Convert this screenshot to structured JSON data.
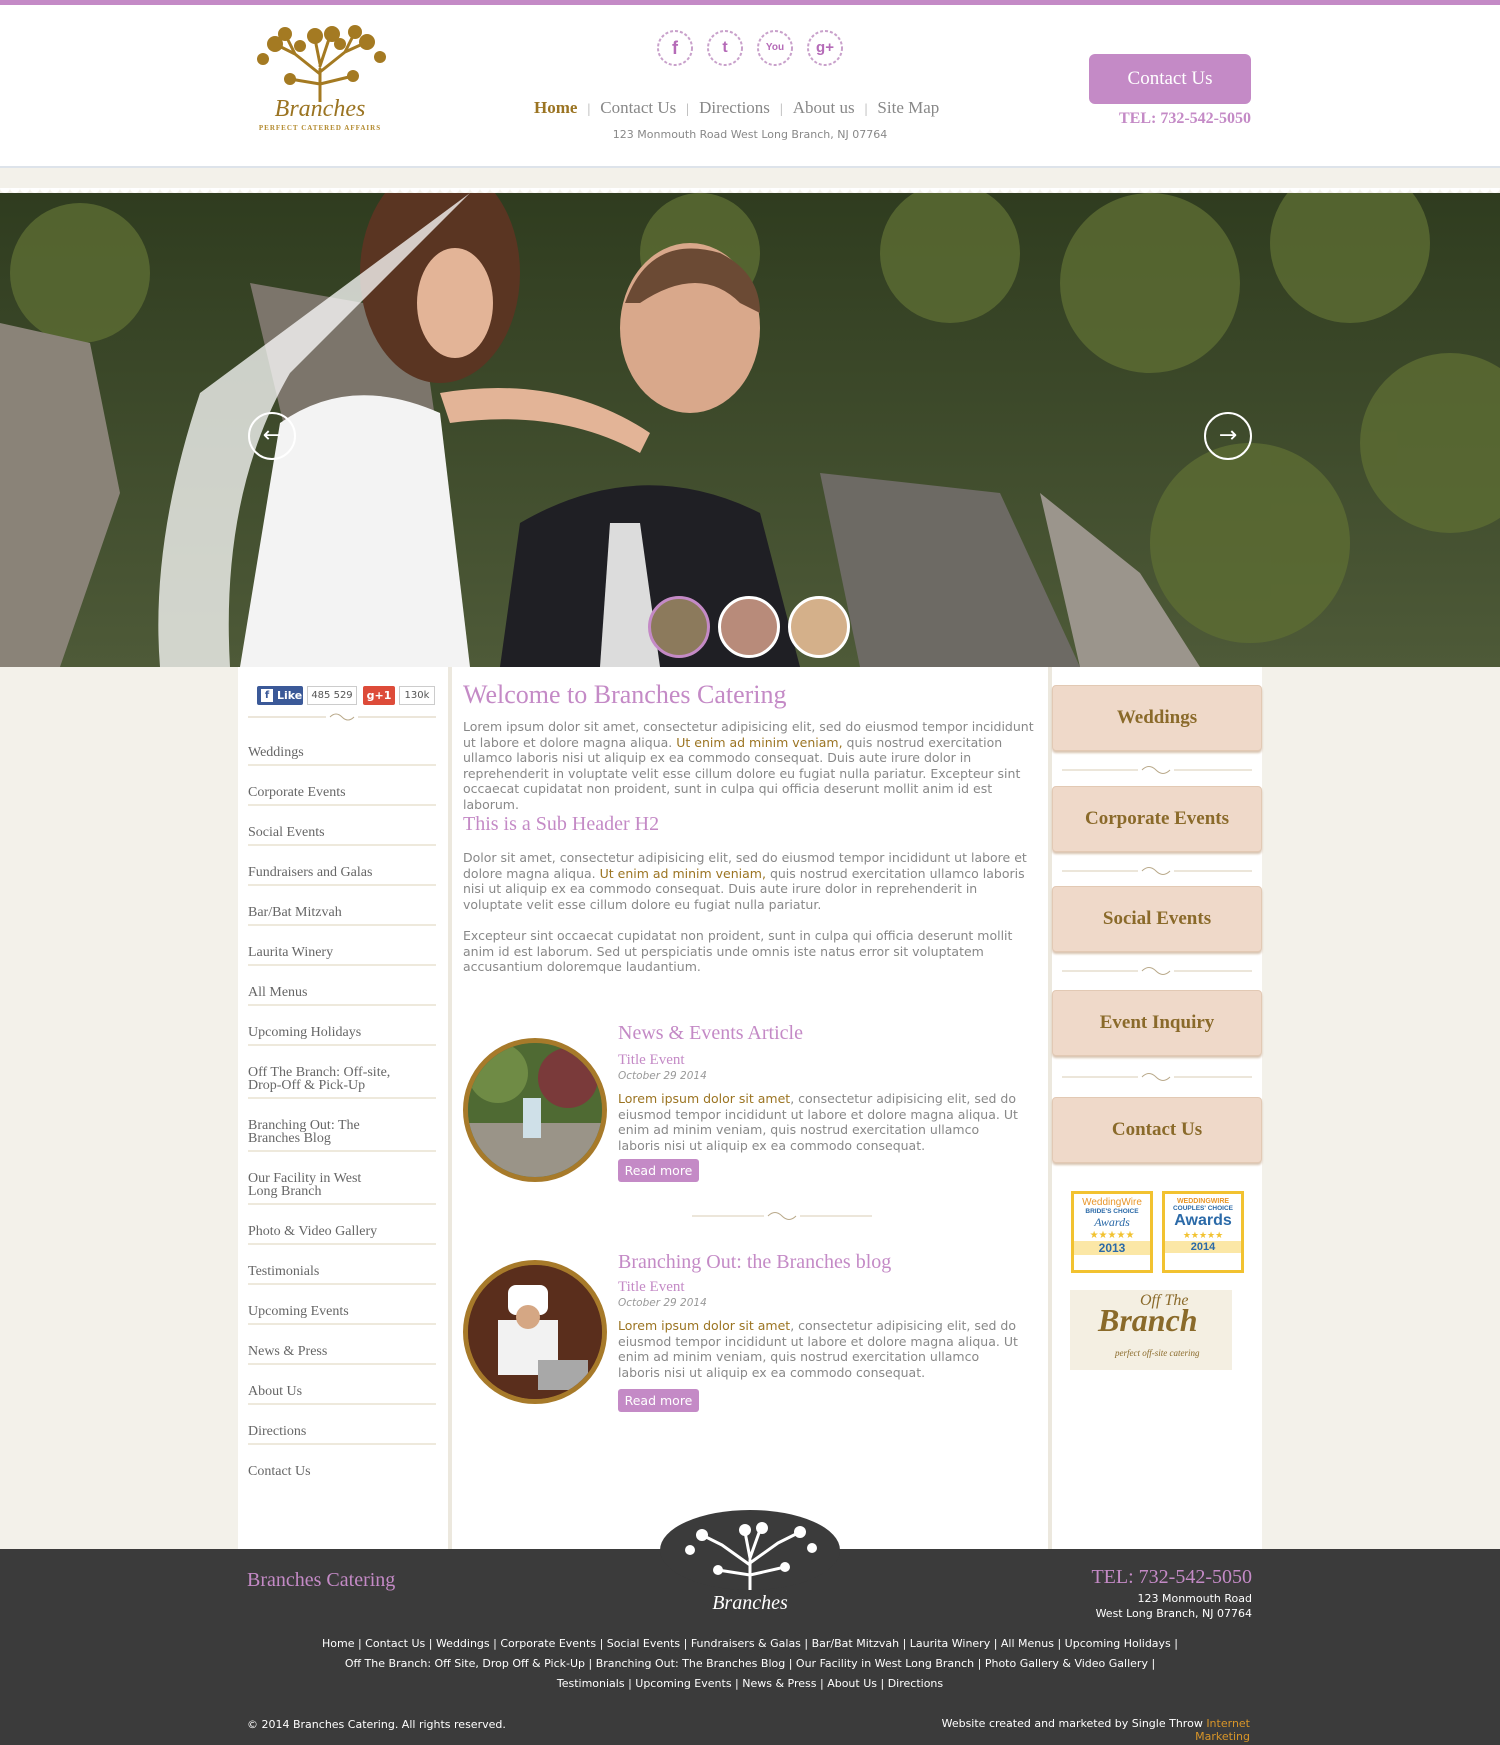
{
  "header": {
    "logo_brand": "Branches",
    "logo_tagline": "PERFECT CATERED AFFAIRS",
    "social": [
      {
        "icon": "facebook-icon",
        "glyph": "f"
      },
      {
        "icon": "twitter-icon",
        "glyph": "t"
      },
      {
        "icon": "youtube-icon",
        "glyph": "You"
      },
      {
        "icon": "google-plus-icon",
        "glyph": "g+"
      }
    ],
    "nav": [
      "Home",
      "Contact Us",
      "Directions",
      "About us",
      "Site Map"
    ],
    "address": "123 Monmouth Road West Long Branch, NJ 07764",
    "contact_button": "Contact Us",
    "tel": "TEL: 732-542-5050"
  },
  "hero": {
    "prev_arrow": "←",
    "next_arrow": "→"
  },
  "left_social": {
    "fb_like": "Like",
    "fb_count": "485 529",
    "gplus": "g+1",
    "gplus_count": "130k"
  },
  "left_menu": [
    "Weddings",
    "Corporate Events",
    "Social Events",
    "Fundraisers and Galas",
    "Bar/Bat Mitzvah",
    "Laurita Winery",
    "All Menus",
    "Upcoming Holidays",
    "Off The Branch: Off-site,",
    "Drop-Off & Pick-Up",
    "Branching Out: The",
    "Branches Blog",
    "Our Facility in West",
    "Long Branch",
    "Photo & Video Gallery",
    "Testimonials",
    "Upcoming Events",
    "News & Press",
    "About Us",
    "Directions",
    "Contact Us"
  ],
  "main": {
    "welcome_title": "Welcome to Branches Catering",
    "p1_a": "Lorem ipsum dolor sit amet, consectetur adipisicing elit, sed do eiusmod tempor incididunt ut labore et dolore magna aliqua. ",
    "p1_hl": "Ut enim ad minim veniam,",
    "p1_b": " quis nostrud exercitation ullamco laboris nisi ut aliquip ex ea commodo consequat. Duis aute irure dolor in reprehenderit in voluptate velit esse cillum dolore eu fugiat nulla pariatur. Excepteur sint occaecat cupidatat non proident, sunt in culpa qui officia deserunt mollit anim id est laborum.",
    "sub_header": "This is a Sub Header H2",
    "p2_a": "Dolor sit amet, consectetur adipisicing elit, sed do eiusmod tempor incididunt ut labore et dolore magna aliqua. ",
    "p2_hl": "Ut enim ad minim veniam,",
    "p2_b": " quis nostrud exercitation ullamco laboris nisi ut aliquip ex ea commodo consequat. Duis aute irure dolor in reprehenderit in voluptate velit esse cillum dolore eu fugiat nulla pariatur.",
    "p3": "Excepteur sint occaecat cupidatat non proident, sunt in culpa qui officia deserunt mollit anim id est laborum. Sed ut perspiciatis unde omnis iste natus error sit voluptatem accusantium doloremque laudantium.",
    "news": [
      {
        "title": "News & Events Article",
        "subtitle": "Title Event",
        "date": "October 29 2014",
        "body_hl": "Lorem ipsum dolor sit amet",
        "body": ", consectetur adipisicing elit, sed do eiusmod tempor incididunt ut labore et dolore magna aliqua. Ut enim ad minim veniam, quis nostrud exercitation ullamco laboris nisi ut aliquip ex ea commodo consequat.",
        "read_more": "Read more"
      },
      {
        "title": "Branching Out: the Branches blog",
        "subtitle": "Title Event",
        "date": "October 29 2014",
        "body_hl": "Lorem ipsum dolor sit amet",
        "body": ", consectetur adipisicing elit, sed do eiusmod tempor incididunt ut labore et dolore magna aliqua. Ut enim ad minim veniam, quis nostrud exercitation ullamco laboris nisi ut aliquip ex ea commodo consequat.",
        "read_more": "Read more"
      }
    ]
  },
  "right_menu": [
    "Weddings",
    "Corporate Events",
    "Social Events",
    "Event Inquiry",
    "Contact Us"
  ],
  "awards": [
    {
      "top": "WeddingWire",
      "mid": "BRIDE'S CHOICE",
      "main": "Awards",
      "year": "2013"
    },
    {
      "top": "WEDDINGWIRE",
      "mid": "COUPLES' CHOICE",
      "main": "Awards",
      "year": "2014"
    }
  ],
  "off_branch": {
    "line1": "Off The",
    "line2": "Branch",
    "line3": "perfect off-site catering"
  },
  "footer": {
    "name": "Branches Catering",
    "logo_text": "Branches",
    "tel": "TEL: 732-542-5050",
    "addr1": "123 Monmouth Road",
    "addr2": "West Long Branch, NJ 07764",
    "links1": "Home | Contact Us | Weddings | Corporate Events | Social Events | Fundraisers & Galas | Bar/Bat Mitzvah | Laurita Winery | All Menus | Upcoming Holidays |",
    "links2": "Off The Branch: Off Site, Drop Off & Pick-Up | Branching Out: The Branches Blog | Our Facility in West Long Branch | Photo Gallery & Video Gallery |",
    "links3": "Testimonials | Upcoming Events | News & Press | About Us | Directions",
    "copyright": "© 2014 Branches Catering. All rights reserved.",
    "credit_a": "Website created and marketed by Single Throw ",
    "credit_b": "Internet Marketing"
  },
  "colors": {
    "accent": "#c48ac6",
    "gold": "#9b7422",
    "footer_bg": "#3b3b3b"
  }
}
